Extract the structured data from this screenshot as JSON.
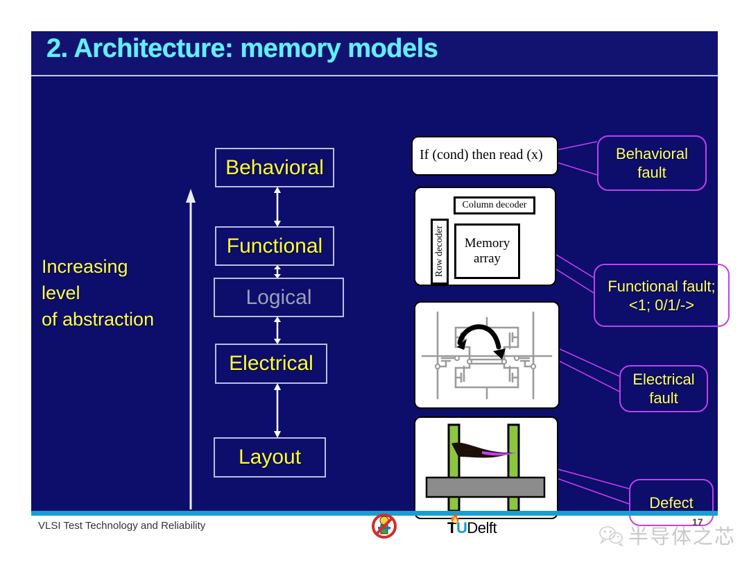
{
  "slide": {
    "title": "2. Architecture: memory models",
    "left_label_lines": [
      "Increasing",
      "level",
      "of abstraction"
    ],
    "levels": [
      {
        "label": "Behavioral",
        "dim": false
      },
      {
        "label": "Functional",
        "dim": false
      },
      {
        "label": "Logical",
        "dim": true
      },
      {
        "label": "Electrical",
        "dim": false
      },
      {
        "label": "Layout",
        "dim": false
      }
    ],
    "panels": {
      "behavioral_code": "If (cond) then read (x)",
      "functional": {
        "column_decoder": "Column decoder",
        "row_decoder": "Row decoder",
        "memory_line1": "Memory",
        "memory_line2": "array"
      }
    },
    "callouts": [
      {
        "line1": "Behavioral",
        "line2": "fault"
      },
      {
        "line1": "Functional fault;",
        "line2": "<1; 0/1/->"
      },
      {
        "line1": "Electrical",
        "line2": "fault"
      },
      {
        "line1": "Defect",
        "line2": ""
      }
    ]
  },
  "footer": {
    "course": "VLSI Test Technology and Reliability",
    "university_t": "T",
    "university_u": "U",
    "university_delft": "Delft",
    "page_number": "17",
    "watermark": "半导体之芯"
  },
  "colors": {
    "slide_background": "#0d0d6b",
    "title_text": "#63eefb",
    "level_text": "#ffff33",
    "level_border": "#b9bfe4",
    "callout_border": "#c23ef0",
    "callout_text": "#ffff66",
    "rule": "#1a9dd0",
    "dim_text": "#9aa0b8"
  }
}
